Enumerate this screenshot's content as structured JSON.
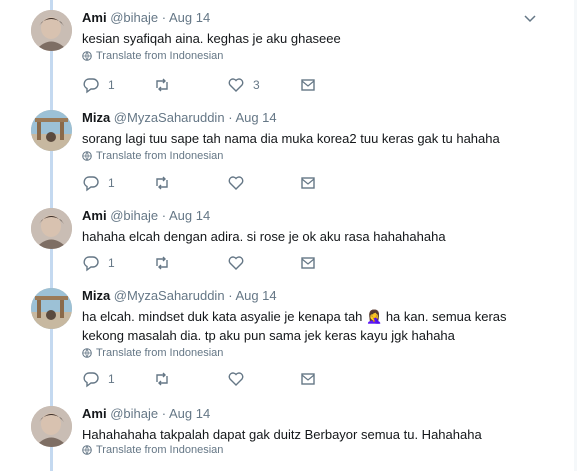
{
  "tweets": [
    {
      "name": "Ami",
      "handle": "@bihaje",
      "date": "Aug 14",
      "text": "kesian syafiqah aina. keghas je aku ghaseee",
      "translate": "Translate from Indonesian",
      "reply_count": "1",
      "retweet_count": "",
      "like_count": "3"
    },
    {
      "name": "Miza",
      "handle": "@MyzaSaharuddin",
      "date": "Aug 14",
      "text": "sorang lagi tuu sape tah nama dia muka korea2 tuu keras gak tu hahaha",
      "translate": "Translate from Indonesian",
      "reply_count": "1",
      "retweet_count": "",
      "like_count": ""
    },
    {
      "name": "Ami",
      "handle": "@bihaje",
      "date": "Aug 14",
      "text": "hahaha elcah dengan adira. si rose je ok aku rasa hahahahaha",
      "translate": "",
      "reply_count": "1",
      "retweet_count": "",
      "like_count": ""
    },
    {
      "name": "Miza",
      "handle": "@MyzaSaharuddin",
      "date": "Aug 14",
      "text_line1": "ha elcah. mindset duk kata asyalie je kenapa tah",
      "emoji": "🤦‍♀️",
      "text_line1b": " ha kan. semua keras",
      "text_line2": "kekong masalah dia. tp aku pun sama jek keras kayu jgk hahaha",
      "translate": "Translate from Indonesian",
      "reply_count": "1",
      "retweet_count": "",
      "like_count": ""
    },
    {
      "name": "Ami",
      "handle": "@bihaje",
      "date": "Aug 14",
      "text": "Hahahahaha takpalah dapat gak duitz Berbayor semua tu. Hahahaha",
      "translate": "Translate from Indonesian",
      "reply_count": "",
      "retweet_count": "",
      "like_count": ""
    }
  ],
  "meta_sep": "·",
  "icons": {
    "reply": "reply-icon",
    "retweet": "retweet-icon",
    "like": "heart-icon",
    "dm": "envelope-icon",
    "more": "chevron-down-icon",
    "translate": "globe-icon"
  },
  "colors": {
    "thread_line": "#c4d9f0",
    "muted": "#657786",
    "text": "#14171a"
  }
}
